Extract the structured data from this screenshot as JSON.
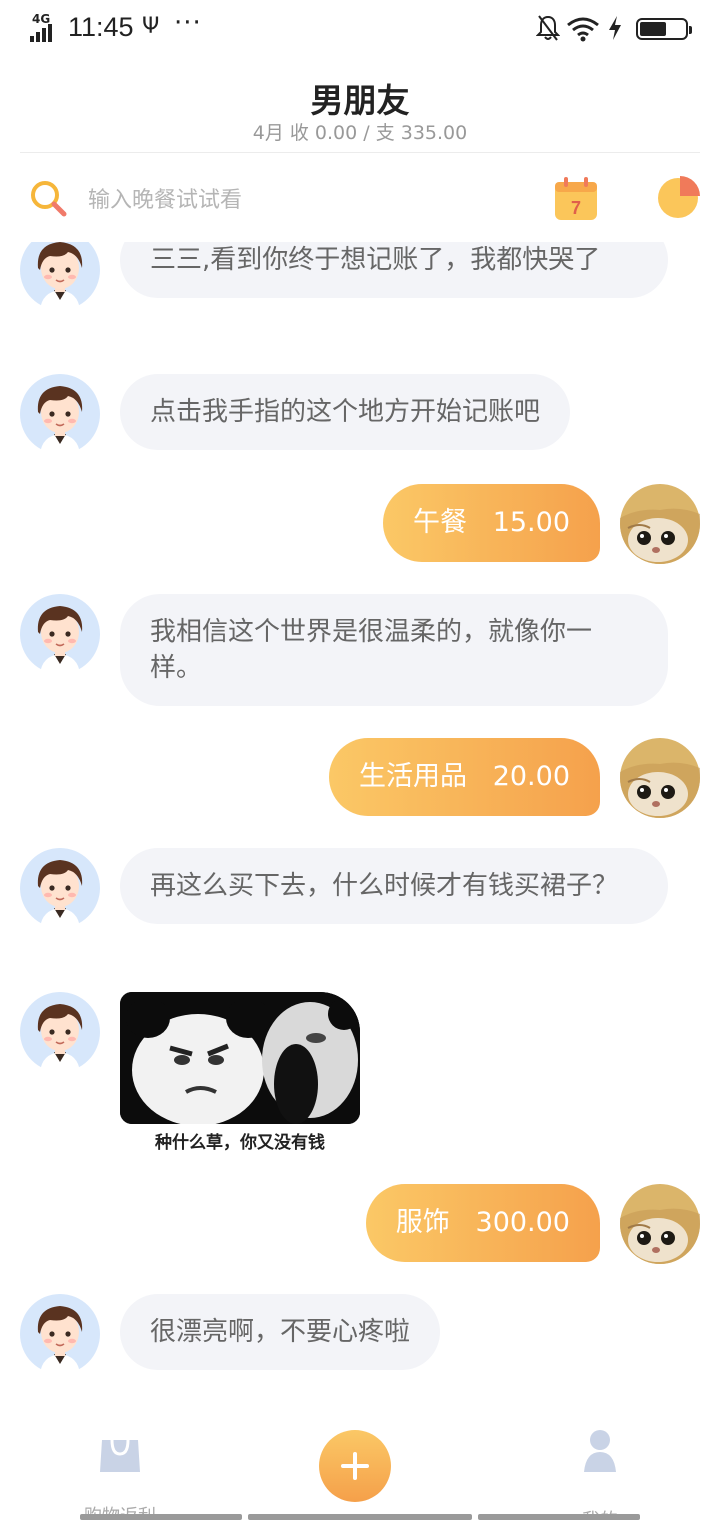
{
  "status_bar": {
    "network": "4G",
    "time": "11:45",
    "usb_icon": "usb-icon",
    "dots": "···",
    "icons": [
      "bell-off-icon",
      "wifi-icon",
      "charging-icon",
      "battery-icon"
    ],
    "battery_level_percent": 60
  },
  "header": {
    "title": "男朋友",
    "summary": "4月 收 0.00 / 支 335.00"
  },
  "search": {
    "placeholder": "输入晚餐试试看",
    "value": "",
    "icon": "search-icon"
  },
  "toolbar": {
    "calendar_day": "7",
    "calendar_icon": "calendar-icon",
    "stats_icon": "pie-chart-icon"
  },
  "messages": [
    {
      "side": "left",
      "text": "三三,看到你终于想记账了，我都快哭了"
    },
    {
      "side": "left",
      "text": "点击我手指的这个地方开始记账吧"
    },
    {
      "side": "right",
      "text": "午餐   15.00"
    },
    {
      "side": "left",
      "text": "我相信这个世界是很温柔的，就像你一样。"
    },
    {
      "side": "right",
      "text": "生活用品   20.00"
    },
    {
      "side": "left",
      "text": "再这么买下去，什么时候才有钱买裙子？"
    },
    {
      "side": "left",
      "type": "image",
      "caption": "种什么草，你又没有钱"
    },
    {
      "side": "right",
      "text": "服饰   300.00"
    },
    {
      "side": "left",
      "text": "很漂亮啊，不要心疼啦"
    }
  ],
  "bottom_nav": {
    "shop_label": "购物返利",
    "add_icon": "plus-icon",
    "me_label": "我的"
  },
  "colors": {
    "accent_start": "#fbc866",
    "accent_end": "#f5a14c",
    "bubble_bg": "#f3f4f8",
    "bubble_text": "#666666"
  }
}
